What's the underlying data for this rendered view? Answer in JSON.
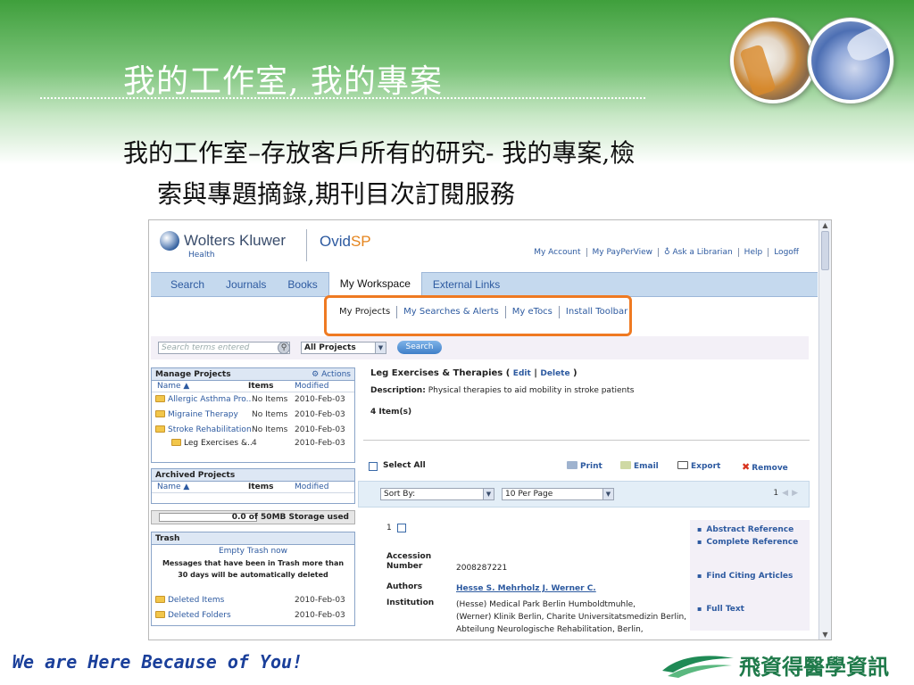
{
  "slide": {
    "title": "我的工作室, 我的專案",
    "bullet_line1": "我的工作室–存放客戶所有的研究- 我的專案,檢",
    "bullet_line2": "索與專題摘錄,期刊目次訂閱服務",
    "tagline": "We are Here Because of You!",
    "brand_name": "飛資得醫學資訊",
    "colors": {
      "header_green": "#3f9f3c",
      "tagline_blue": "#1a3f9a",
      "highlight_orange": "#ef7a22"
    }
  },
  "ovid": {
    "logo_company": "Wolters Kluwer",
    "logo_company_sub": "Health",
    "logo_product_a": "Ovid",
    "logo_product_b": "SP",
    "top_links": [
      "My Account",
      "My PayPerView",
      "♁ Ask a Librarian",
      "Help",
      "Logoff"
    ],
    "nav_tabs": [
      {
        "label": "Search",
        "active": false
      },
      {
        "label": "Journals",
        "active": false
      },
      {
        "label": "Books",
        "active": false
      },
      {
        "label": "My Workspace",
        "active": true
      },
      {
        "label": "External Links",
        "active": false
      }
    ],
    "subnav": [
      "My Projects",
      "My Searches & Alerts",
      "My eTocs",
      "Install Toolbar"
    ],
    "search": {
      "placeholder": "Search terms entered",
      "scope": "All Projects",
      "button": "Search"
    },
    "manage_projects": {
      "title": "Manage Projects",
      "actions": "Actions",
      "col_name": "Name ▲",
      "col_items": "Items",
      "col_modified": "Modified",
      "rows": [
        {
          "name": "Allergic Asthma Pro...",
          "items": "No Items",
          "modified": "2010-Feb-03"
        },
        {
          "name": "Migraine Therapy",
          "items": "No Items",
          "modified": "2010-Feb-03"
        },
        {
          "name": "Stroke Rehabilitation",
          "items": "No Items",
          "modified": "2010-Feb-03"
        },
        {
          "name": "Leg Exercises &...",
          "items": "4",
          "modified": "2010-Feb-03"
        }
      ]
    },
    "archived_projects": {
      "title": "Archived Projects",
      "col_name": "Name ▲",
      "col_items": "Items",
      "col_modified": "Modified"
    },
    "storage": "0.0 of 50MB Storage used",
    "trash": {
      "title": "Trash",
      "empty": "Empty Trash now",
      "note_line1": "Messages that have been in Trash more than",
      "note_line2": "30 days will be automatically deleted",
      "rows": [
        {
          "name": "Deleted Items",
          "modified": "2010-Feb-03"
        },
        {
          "name": "Deleted Folders",
          "modified": "2010-Feb-03"
        }
      ]
    },
    "project": {
      "title": "Leg Exercises & Therapies",
      "edit": "Edit",
      "delete": "Delete",
      "desc_label": "Description:",
      "desc": "Physical therapies to aid mobility in stroke patients",
      "count": "4 Item(s)"
    },
    "toolbar": {
      "select_all": "Select All",
      "print": "Print",
      "email": "Email",
      "export": "Export",
      "remove": "Remove"
    },
    "sort": {
      "sort_by": "Sort By:",
      "per_page": "10 Per Page",
      "page": "1"
    },
    "record": {
      "number": "1",
      "accession_label_a": "Accession",
      "accession_label_b": "Number",
      "accession": "2008287221",
      "authors_label": "Authors",
      "authors": "Hesse S. Mehrholz J. Werner C.",
      "institution_label": "Institution",
      "inst_line1": "(Hesse) Medical Park Berlin Humboldtmuhle,",
      "inst_line2": "(Werner) Klinik Berlin, Charite Universitatsmedizin Berlin,",
      "inst_line3": "Abteilung Neurologische Rehabilitation, Berlin,"
    },
    "side_links": [
      "Abstract Reference",
      "Complete Reference",
      "Find Citing Articles",
      "Full Text"
    ]
  }
}
